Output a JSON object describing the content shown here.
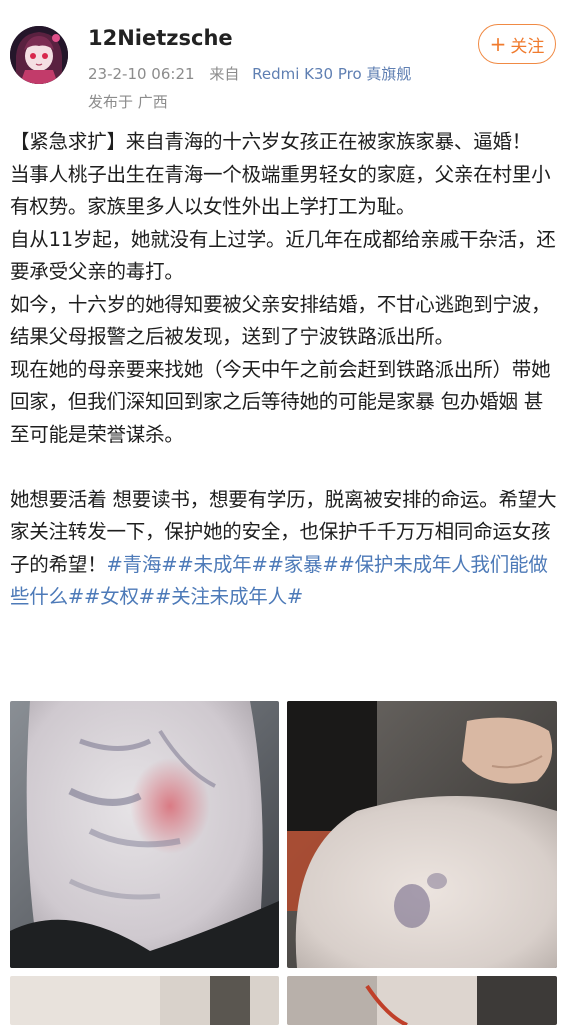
{
  "post": {
    "username": "12Nietzsche",
    "timestamp": "23-2-10 06:21",
    "source_prefix": "来自",
    "device": "Redmi K30 Pro 真旗舰",
    "location": "发布于 广西",
    "follow_label": "关注",
    "follow_plus": "+",
    "paragraphs": [
      "【紧急求扩】来自青海的十六岁女孩正在被家族家暴、逼婚！",
      "当事人桃子出生在青海一个极端重男轻女的家庭，父亲在村里小有权势。家族里多人以女性外出上学打工为耻。",
      "自从11岁起，她就没有上过学。近几年在成都给亲戚干杂活，还要承受父亲的毒打。",
      "如今，十六岁的她得知要被父亲安排结婚，不甘心逃跑到宁波，结果父母报警之后被发现，送到了宁波铁路派出所。",
      "现在她的母亲要来找她（今天中午之前会赶到铁路派出所）带她回家，但我们深知回到家之后等待她的可能是家暴 包办婚姻 甚至可能是荣誉谋杀。"
    ],
    "closing_text": "她想要活着 想要读书，想要有学历，脱离被安排的命运。希望大家关注转发一下，保护她的安全，也保护千千万万相同命运女孩子的希望！",
    "hashtags": [
      "#青海#",
      "#未成年#",
      "#家暴#",
      "#保护未成年人我们能做些什么#",
      "#女权#",
      "#关注未成年人#"
    ]
  },
  "colors": {
    "link": "#4d7ab8",
    "device": "#5f7fb2",
    "follow": "#f07b2e",
    "meta": "#8c8c8c"
  },
  "icons": {
    "avatar": "anime-avatar"
  }
}
